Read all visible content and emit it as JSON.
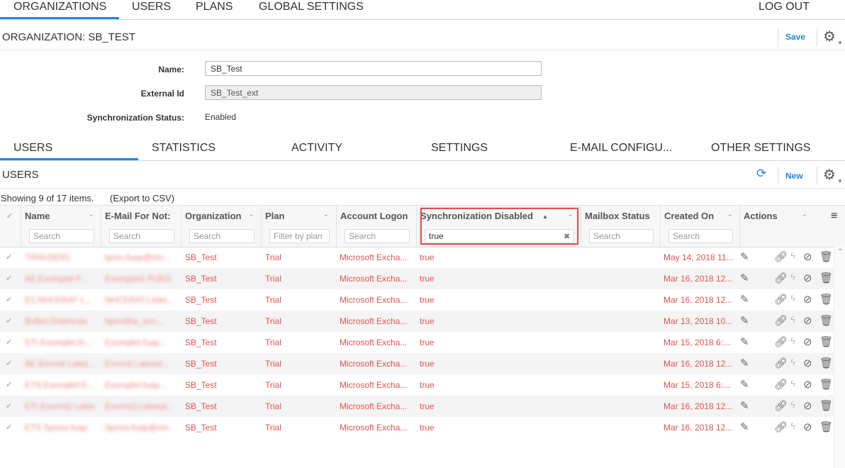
{
  "topnav": {
    "items": [
      "ORGANIZATIONS",
      "USERS",
      "PLANS",
      "GLOBAL SETTINGS"
    ],
    "logout": "LOG OUT"
  },
  "org": {
    "title": "ORGANIZATION: SB_TEST",
    "save": "Save"
  },
  "form": {
    "name_label": "Name:",
    "name_value": "SB_Test",
    "extid_label": "External Id",
    "extid_value": "SB_Test_ext",
    "sync_label": "Synchronization Status:",
    "sync_value": "Enabled"
  },
  "tabs": [
    "USERS",
    "STATISTICS",
    "ACTIVITY",
    "SETTINGS",
    "E-MAIL CONFIGU...",
    "OTHER SETTINGS"
  ],
  "users_panel": {
    "title": "USERS",
    "new": "New",
    "showing": "Showing 9 of 17 items.",
    "export": "(Export to CSV)"
  },
  "columns": [
    {
      "label": "Name",
      "filter": "Search"
    },
    {
      "label": "E-Mail For Not:",
      "filter": "Search"
    },
    {
      "label": "Organization",
      "filter": "Search"
    },
    {
      "label": "Plan",
      "filter": "Filter by plan"
    },
    {
      "label": "Account Logon",
      "filter": "Search"
    },
    {
      "label": "Synchronization Disabled",
      "filter": "true"
    },
    {
      "label": "Mailbox Status",
      "filter": "Search"
    },
    {
      "label": "Created On",
      "filter": "Search"
    },
    {
      "label": "Actions",
      "filter": ""
    }
  ],
  "rows": [
    {
      "name": "TRNUSER1",
      "email": "tpnm.fuap@mn...",
      "org": "SB_Test",
      "plan": "Trial",
      "logon": "Microsoft Excha...",
      "sync": "true",
      "created": "May 14, 2018 11..."
    },
    {
      "name": "AE.Exomplet F...",
      "email": "Exomplet1.PUED...",
      "org": "SB_Test",
      "plan": "Trial",
      "logon": "Microsoft Excha...",
      "sync": "true",
      "created": "Mar 16, 2018 12..."
    },
    {
      "name": "E1.NHCERAT L...",
      "email": "NHCERAT.Liebs...",
      "org": "SB_Test",
      "plan": "Trial",
      "logon": "Microsoft Excha...",
      "sync": "true",
      "created": "Mar 16, 2018 12..."
    },
    {
      "name": "Bvlbm.Dotehnas",
      "email": "bpmotha_ecc...",
      "org": "SB_Test",
      "plan": "Trial",
      "logon": "Microsoft Excha...",
      "sync": "true",
      "created": "Mar 13, 2018 10..."
    },
    {
      "name": "ETI.Exomplet.fn...",
      "email": "Exomplet.fuap...",
      "org": "SB_Test",
      "plan": "Trial",
      "logon": "Microsoft Excha...",
      "sync": "true",
      "created": "Mar 15, 2018 6:..."
    },
    {
      "name": "AE.Envrmt Lales...",
      "email": "Envrmt.Lalesot...",
      "org": "SB_Test",
      "plan": "Trial",
      "logon": "Microsoft Excha...",
      "sync": "true",
      "created": "Mar 16, 2018 12..."
    },
    {
      "name": "ETS.Exomplet.fr...",
      "email": "Exomplet.fuap...",
      "org": "SB_Test",
      "plan": "Trial",
      "logon": "Microsoft Excha...",
      "sync": "true",
      "created": "Mar 15, 2018 6:..."
    },
    {
      "name": "ETI.Envrmt2 Lales...",
      "email": "Envrmt2.Lalesot...",
      "org": "SB_Test",
      "plan": "Trial",
      "logon": "Microsoft Excha...",
      "sync": "true",
      "created": "Mar 16, 2018 12..."
    },
    {
      "name": "ETS.Spnno.fuap",
      "email": "Spnno.fuap@mn...",
      "org": "SB_Test",
      "plan": "Trial",
      "logon": "Microsoft Excha...",
      "sync": "true",
      "created": "Mar 16, 2018 12..."
    }
  ],
  "icons": {
    "gear": "gear-icon",
    "refresh": "refresh-icon",
    "edit": "pencil-icon",
    "link": "link-icon",
    "bolt": "lightning-icon",
    "disable": "block-icon",
    "delete": "trash-icon",
    "menu": "hamburger-icon"
  },
  "colors": {
    "accent": "#1e88e5",
    "row_text": "#e05252",
    "highlight": "#e05252"
  }
}
